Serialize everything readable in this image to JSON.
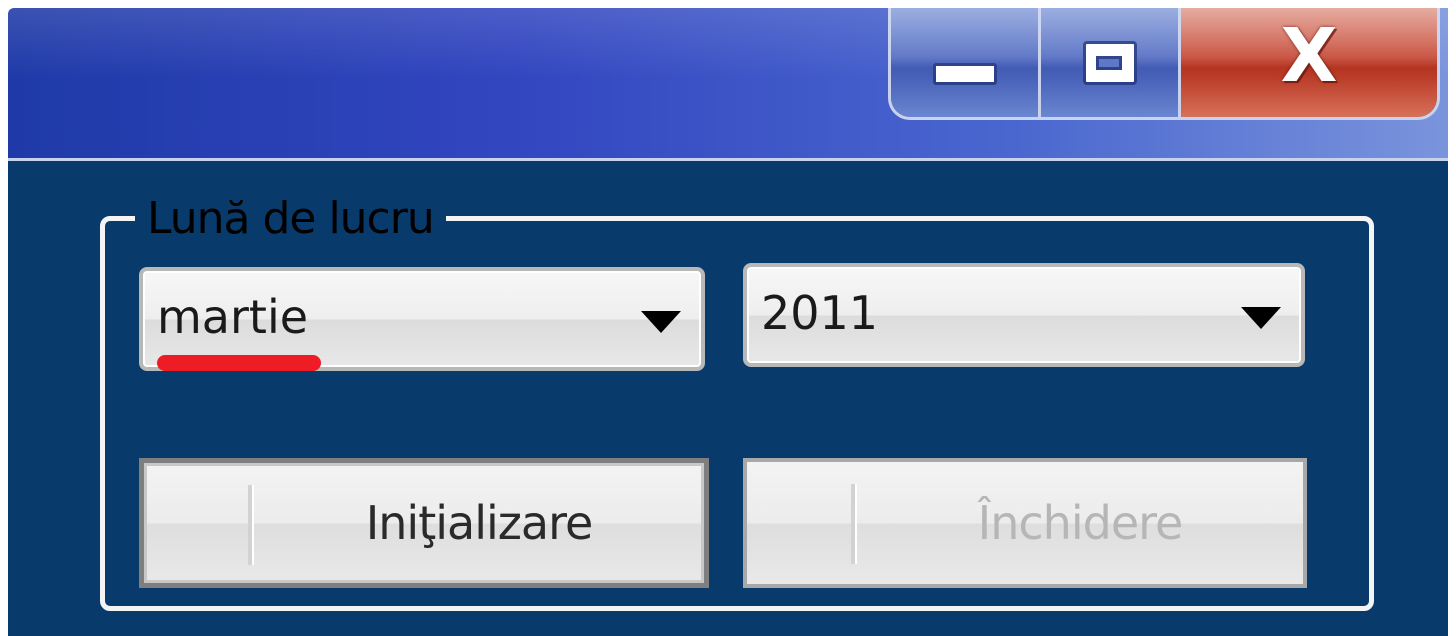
{
  "window": {
    "controls": {
      "minimize_icon": "minimize-icon",
      "maximize_icon": "maximize-icon",
      "close_icon": "close-icon",
      "close_glyph": "X"
    },
    "colors": {
      "titlebar_start": "#1f3aa8",
      "titlebar_end": "#7a94dc",
      "panel_background": "#083a6b",
      "close_button": "#c9513f",
      "annotation_underline": "#ee1c24"
    }
  },
  "work_month": {
    "legend": "Lună de lucru",
    "month_select": {
      "value": "martie",
      "icon": "chevron-down-icon"
    },
    "year_select": {
      "value": "2011",
      "icon": "chevron-down-icon"
    }
  },
  "actions": {
    "initialize_label": "Iniţializare",
    "close_label": "Închidere",
    "close_enabled": false
  }
}
